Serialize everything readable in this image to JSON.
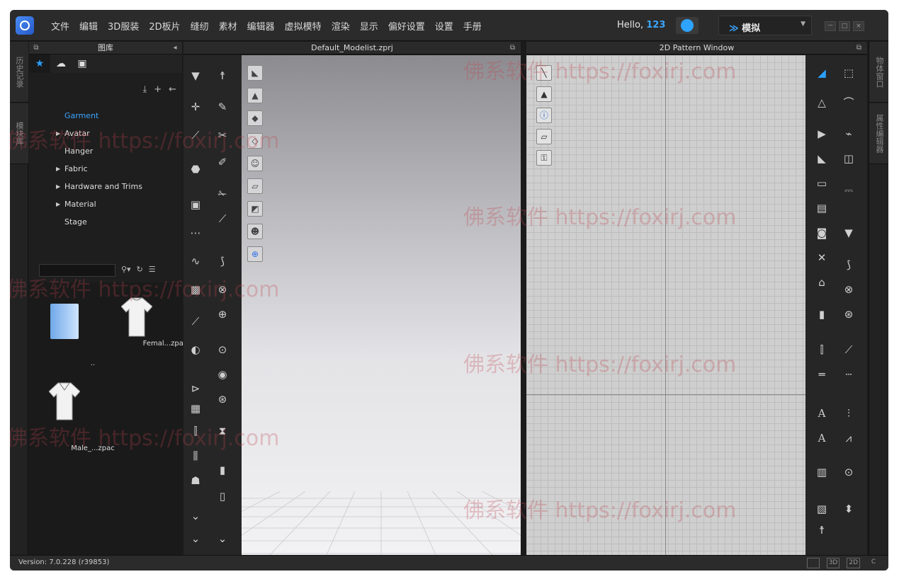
{
  "menu": [
    "文件",
    "编辑",
    "3D服装",
    "2D板片",
    "缝纫",
    "素材",
    "编辑器",
    "虚拟模特",
    "渲染",
    "显示",
    "偏好设置",
    "设置",
    "手册"
  ],
  "user": {
    "greeting": "Hello,",
    "name": "123"
  },
  "mode": {
    "label": "模拟",
    "icon": "double-chevron-down-icon"
  },
  "window_buttons": [
    "－",
    "□",
    "×"
  ],
  "left_tabs": [
    "历史记录",
    "模块库"
  ],
  "right_tabs": [
    "物体窗口",
    "属性编辑器"
  ],
  "library": {
    "title": "图库",
    "tabs": [
      "star-icon",
      "cloud-icon",
      "bag-icon"
    ],
    "tree": [
      {
        "label": "Garment",
        "expandable": false,
        "selected": true
      },
      {
        "label": "Avatar",
        "expandable": true,
        "selected": false
      },
      {
        "label": "Hanger",
        "expandable": false,
        "selected": false
      },
      {
        "label": "Fabric",
        "expandable": true,
        "selected": false
      },
      {
        "label": "Hardware and Trims",
        "expandable": true,
        "selected": false
      },
      {
        "label": "Material",
        "expandable": true,
        "selected": false
      },
      {
        "label": "Stage",
        "expandable": false,
        "selected": false
      }
    ],
    "search_placeholder": "",
    "items": [
      {
        "label": "..",
        "kind": "folder"
      },
      {
        "label": "Femal...zpac",
        "kind": "shirt"
      },
      {
        "label": "Male_...zpac",
        "kind": "shirt"
      }
    ]
  },
  "viewport3d": {
    "title": "Default_Modelist.zprj"
  },
  "viewport2d": {
    "title": "2D Pattern Window"
  },
  "watermark": "佛系软件 https://foxirj.com",
  "status": {
    "version": "Version: 7.0.228 (r39853)",
    "views": [
      "",
      "3D",
      "2D",
      "C"
    ]
  },
  "colors": {
    "accent": "#2aa0ff",
    "bg": "#1b1b1b",
    "panel": "#262626"
  }
}
